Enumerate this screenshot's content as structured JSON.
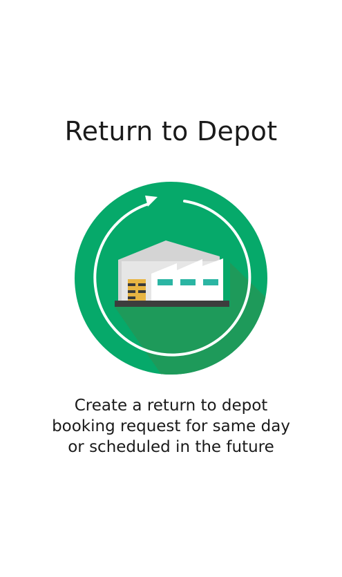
{
  "screen": {
    "title": "Return to Depot",
    "description": "Create a return to depot booking request for same day or scheduled in the future"
  },
  "illustration": {
    "icon": "depot-return-icon",
    "colors": {
      "circle": "#06a96a",
      "shadow": "#1e9a5a",
      "ring": "#ffffff",
      "building_roof": "#d9d9d9",
      "building_wall": "#e6e6e6",
      "building_front": "#ffffff",
      "windows": "#2bb5a3",
      "boxes": "#e8b543",
      "boxes_dark": "#3a3a3a",
      "ground": "#3d3d3d"
    }
  }
}
